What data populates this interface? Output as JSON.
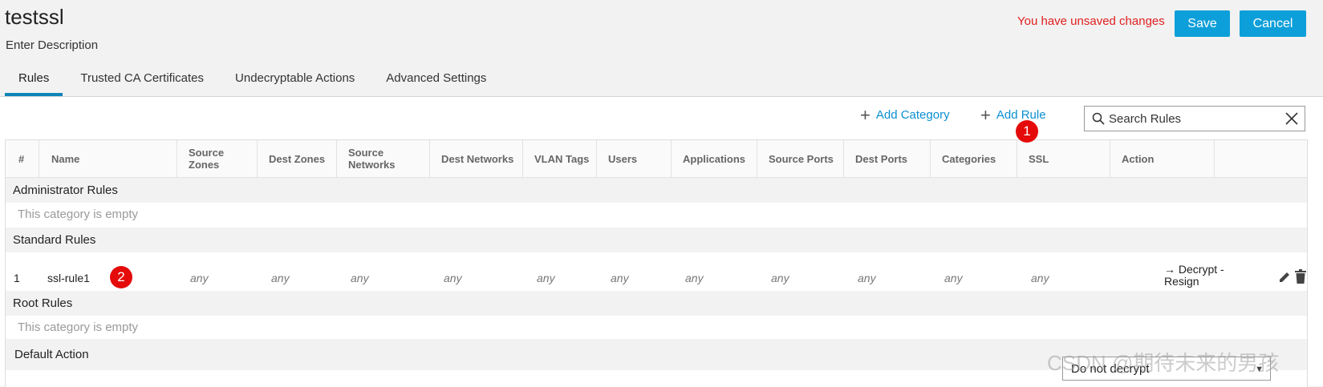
{
  "header": {
    "title": "testssl",
    "description": "Enter Description",
    "unsaved_text": "You have unsaved changes",
    "save_label": "Save",
    "cancel_label": "Cancel"
  },
  "tabs": [
    {
      "label": "Rules",
      "active": true
    },
    {
      "label": "Trusted CA Certificates",
      "active": false
    },
    {
      "label": "Undecryptable Actions",
      "active": false
    },
    {
      "label": "Advanced Settings",
      "active": false
    }
  ],
  "toolbar": {
    "add_category_label": "Add Category",
    "add_rule_label": "Add Rule",
    "search_value": "Search Rules"
  },
  "markers": {
    "m1": "1",
    "m2": "2"
  },
  "table": {
    "columns": [
      "#",
      "Name",
      "Source Zones",
      "Dest Zones",
      "Source Networks",
      "Dest Networks",
      "VLAN Tags",
      "Users",
      "Applications",
      "Source Ports",
      "Dest Ports",
      "Categories",
      "SSL",
      "Action"
    ],
    "categories": {
      "administrator": "Administrator Rules",
      "standard": "Standard Rules",
      "root": "Root Rules",
      "default_action": "Default Action"
    },
    "empty_text": "This category is empty",
    "rule": {
      "num": "1",
      "name": "ssl-rule1",
      "values": [
        "any",
        "any",
        "any",
        "any",
        "any",
        "any",
        "any",
        "any",
        "any",
        "any",
        "any"
      ],
      "action": "→ Decrypt - Resign"
    },
    "default_action_value": "Do not decrypt"
  },
  "watermark": "CSDN @期待未来的男孩",
  "colors": {
    "accent": "#0d9fd9",
    "warning": "#e02020",
    "marker": "#e50b0b",
    "link": "#0b8fd0"
  }
}
